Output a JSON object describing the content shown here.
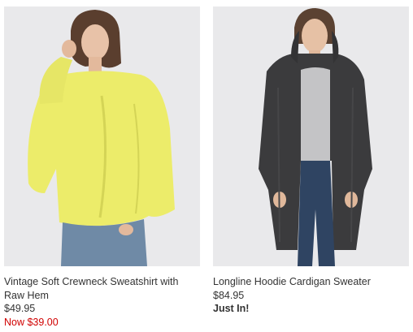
{
  "products": [
    {
      "name": "Vintage Soft Crewneck Sweatshirt with Raw Hem",
      "price": "$49.95",
      "sale_price": "Now $39.00",
      "image_icon": "yellow-sweatshirt-photo",
      "colors": {
        "garment": "#ecec6a",
        "sale": "#d00000"
      }
    },
    {
      "name": "Longline Hoodie Cardigan Sweater",
      "price": "$84.95",
      "badge": "Just In!",
      "image_icon": "charcoal-cardigan-photo",
      "colors": {
        "garment": "#3b3b3d"
      }
    }
  ]
}
